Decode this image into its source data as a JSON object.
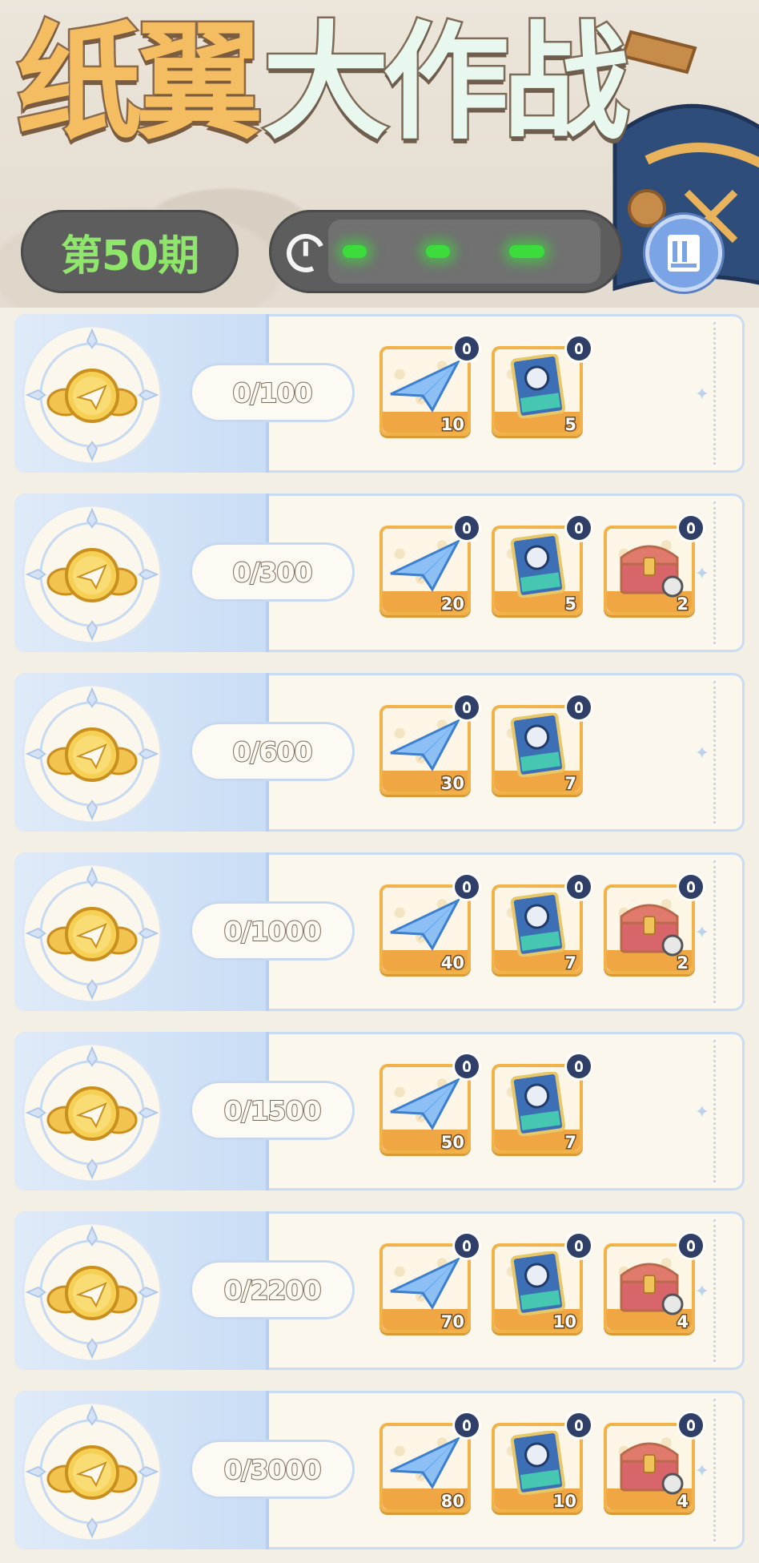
{
  "header": {
    "title_part1": "纸翼",
    "title_part2": "大作战",
    "period": "第50期",
    "timer_icon": "clock-icon",
    "rules_icon": "rules-book-icon"
  },
  "colors": {
    "title_orange": "#f4bd62",
    "title_mint": "#e9f8ef",
    "period_text": "#8ee66a",
    "pill_bg": "#5d5d5d",
    "card_border": "#c9dcf3",
    "reward_frame": "#f1b24a"
  },
  "tiers": [
    {
      "progress": "0/100",
      "rewards": [
        {
          "type": "paper-plane",
          "qty": "10"
        },
        {
          "type": "ticket-card",
          "qty": "5"
        }
      ]
    },
    {
      "progress": "0/300",
      "rewards": [
        {
          "type": "paper-plane",
          "qty": "20"
        },
        {
          "type": "ticket-card",
          "qty": "5"
        },
        {
          "type": "treasure-chest",
          "qty": "2"
        }
      ]
    },
    {
      "progress": "0/600",
      "rewards": [
        {
          "type": "paper-plane",
          "qty": "30"
        },
        {
          "type": "ticket-card",
          "qty": "7"
        }
      ]
    },
    {
      "progress": "0/1000",
      "rewards": [
        {
          "type": "paper-plane",
          "qty": "40"
        },
        {
          "type": "ticket-card",
          "qty": "7"
        },
        {
          "type": "treasure-chest",
          "qty": "2"
        }
      ]
    },
    {
      "progress": "0/1500",
      "rewards": [
        {
          "type": "paper-plane",
          "qty": "50"
        },
        {
          "type": "ticket-card",
          "qty": "7"
        }
      ]
    },
    {
      "progress": "0/2200",
      "rewards": [
        {
          "type": "paper-plane",
          "qty": "70"
        },
        {
          "type": "ticket-card",
          "qty": "10"
        },
        {
          "type": "treasure-chest",
          "qty": "4"
        }
      ]
    },
    {
      "progress": "0/3000",
      "rewards": [
        {
          "type": "paper-plane",
          "qty": "80"
        },
        {
          "type": "ticket-card",
          "qty": "10"
        },
        {
          "type": "treasure-chest",
          "qty": "4"
        }
      ]
    }
  ]
}
